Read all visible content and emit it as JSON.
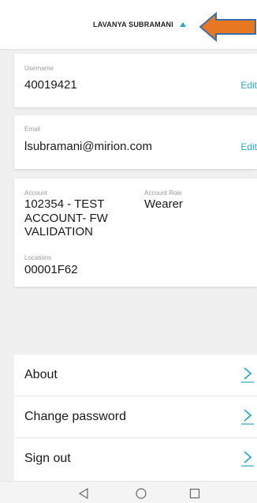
{
  "header": {
    "user_name": "LAVANYA SUBRAMANI"
  },
  "username": {
    "label": "Username",
    "value": "40019421",
    "edit": "Edit"
  },
  "email": {
    "label": "Email",
    "value": "lsubramani@mirion.com",
    "edit": "Edit"
  },
  "account": {
    "label": "Account",
    "value_line1": "102354 - TEST",
    "value_line2": "ACCOUNT- FW",
    "value_line3": "VALIDATION",
    "role_label": "Account Role",
    "role_value": "Wearer",
    "locations_label": "Locations",
    "locations_value": "00001F62"
  },
  "menu": {
    "items": [
      {
        "label": "About"
      },
      {
        "label": "Change password"
      },
      {
        "label": "Sign out"
      }
    ]
  },
  "colors": {
    "accent": "#2aa7c9",
    "annotation_arrow": "#e87722",
    "annotation_outline": "#3a6ea8"
  },
  "icons": {
    "header_caret": "caret-up-icon",
    "menu_chevron": "chevron-right-icon",
    "nav_back": "triangle-back-icon",
    "nav_home": "circle-home-icon",
    "nav_recent": "square-recent-icon"
  }
}
